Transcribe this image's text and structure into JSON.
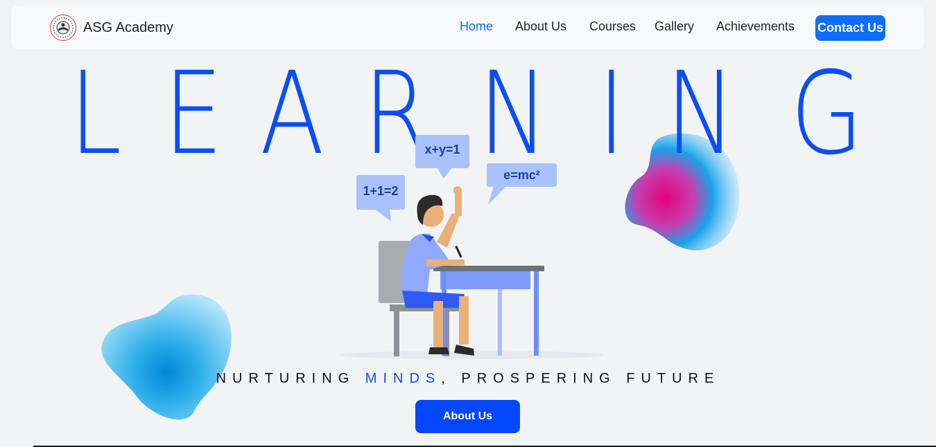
{
  "brand": {
    "name": "ASG Academy",
    "logo_icon": "academy-crest-icon"
  },
  "nav": {
    "items": [
      {
        "label": "Home",
        "active": true
      },
      {
        "label": "About Us",
        "active": false
      },
      {
        "label": "Courses",
        "active": false
      },
      {
        "label": "Gallery",
        "active": false
      },
      {
        "label": "Achievements",
        "active": false
      }
    ],
    "contact_label": "Contact Us"
  },
  "hero": {
    "letters": [
      "L",
      "E",
      "A",
      "R",
      "N",
      "I",
      "N",
      "G"
    ],
    "bubbles": {
      "left": "1+1=2",
      "middle": "x+y=1",
      "right": "e=mc²"
    },
    "tagline": {
      "before": "NURTURING ",
      "accent": "MINDS",
      "after": ", PROSPERING FUTURE"
    },
    "cta_label": "About Us"
  },
  "colors": {
    "accent": "#0a4ff5",
    "nav_active": "#0d6efd",
    "button": "#0546ff",
    "background": "#f2f3f5"
  }
}
